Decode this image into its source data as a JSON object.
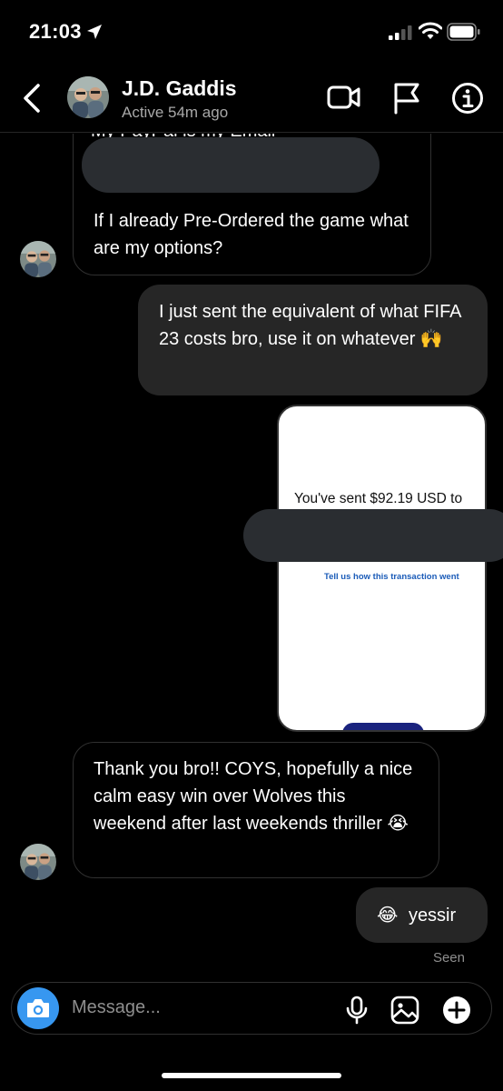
{
  "status_bar": {
    "time": "21:03"
  },
  "header": {
    "name": "J.D. Gaddis",
    "active": "Active 54m ago"
  },
  "messages": {
    "m1_cut": "My PayPal is my Email",
    "m1_text": "If I already Pre-Ordered the game what are my options?",
    "m2_text": "I just sent the equivalent of what FIFA 23 costs bro, use it on whatever 🙌",
    "shot_sent": "You've sent $92.19 USD to",
    "shot_link": "Tell us how this transaction went",
    "m3_text": "Thank you bro!! COYS, hopefully a nice calm easy win over Wolves this weekend after last weekends thriller 😭",
    "m4_text": "yessir",
    "m4_emoji": "😂",
    "seen": "Seen"
  },
  "composer": {
    "placeholder": "Message..."
  },
  "colors": {
    "accent": "#3797f0",
    "bubble_out": "#262626",
    "redaction": "#2a2d31"
  }
}
